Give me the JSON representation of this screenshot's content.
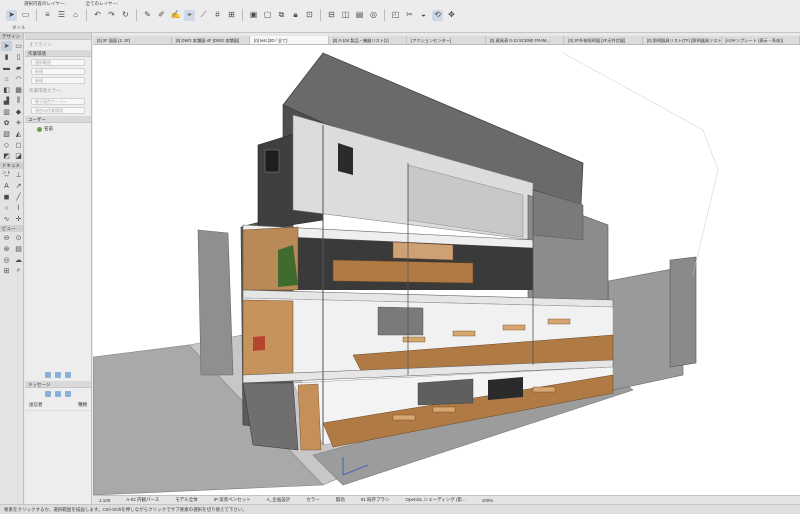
{
  "toolbar": {
    "layer_label_1": "選択内容のレイヤー:",
    "layer_label_2": "全てのレイヤー:",
    "sub_label": "ダイル"
  },
  "palette": {
    "design_header": "デザイン",
    "document_header": "ドキュメント",
    "view_header": "ビュー"
  },
  "infobox": {
    "offline_label": "オフライン",
    "workspace_header": "作業環境",
    "field_1": "選択範囲",
    "field_2": "新規",
    "field_3": "新規",
    "color_label": "作業環境カラー:",
    "color_field": "最下面色サーバー",
    "button_label": "現在の作業環境",
    "users_header": "ユーザー",
    "user_name": "名前",
    "messages_header": "メッセージ",
    "msg_col_1": "送信者",
    "msg_col_2": "種類"
  },
  "tabs": [
    "[0] 2F 図面 [2. 2F]",
    "[0] DWG 本舗図-4F [DWG 本舗図]",
    "[0] test [3D / 全て]",
    "[0] 0-104 製品・機器リスト[1]",
    "[アクションセンター]",
    "[0] 建具表 0-13 SCENE FRAM...",
    "[0] 2F外装照明図 [2F天井伏図]",
    "[0] 照明器具リスト(TF) [照明器具リスト]",
    "[A3テンプレート (表示・系体)]"
  ],
  "active_tab_index": 2,
  "bottombar": {
    "scale": "1:100",
    "layer_combo": "A-02 内観パース",
    "model": "モデル全体",
    "pen_set": "IP 実装ペンセット",
    "display": "A_企画設計",
    "graphic": "カラー",
    "override": "無効",
    "renovation": "01 既存プラン",
    "engine": "OpenGL シェーディング (影...",
    "zoom": "100%"
  },
  "statusbar": {
    "hint": "要素をクリックするか、選択範囲を描画します。Ctrl+Shiftを押しながらクリックでサブ要素の選択を切り替えて下さい。"
  },
  "colors": {
    "toolbar_bg": "#ececec",
    "viewport_bg": "#ffffff",
    "facade_dark": "#5b5b5b",
    "wood": "#b07a45",
    "ground": "#a9a9a9"
  }
}
